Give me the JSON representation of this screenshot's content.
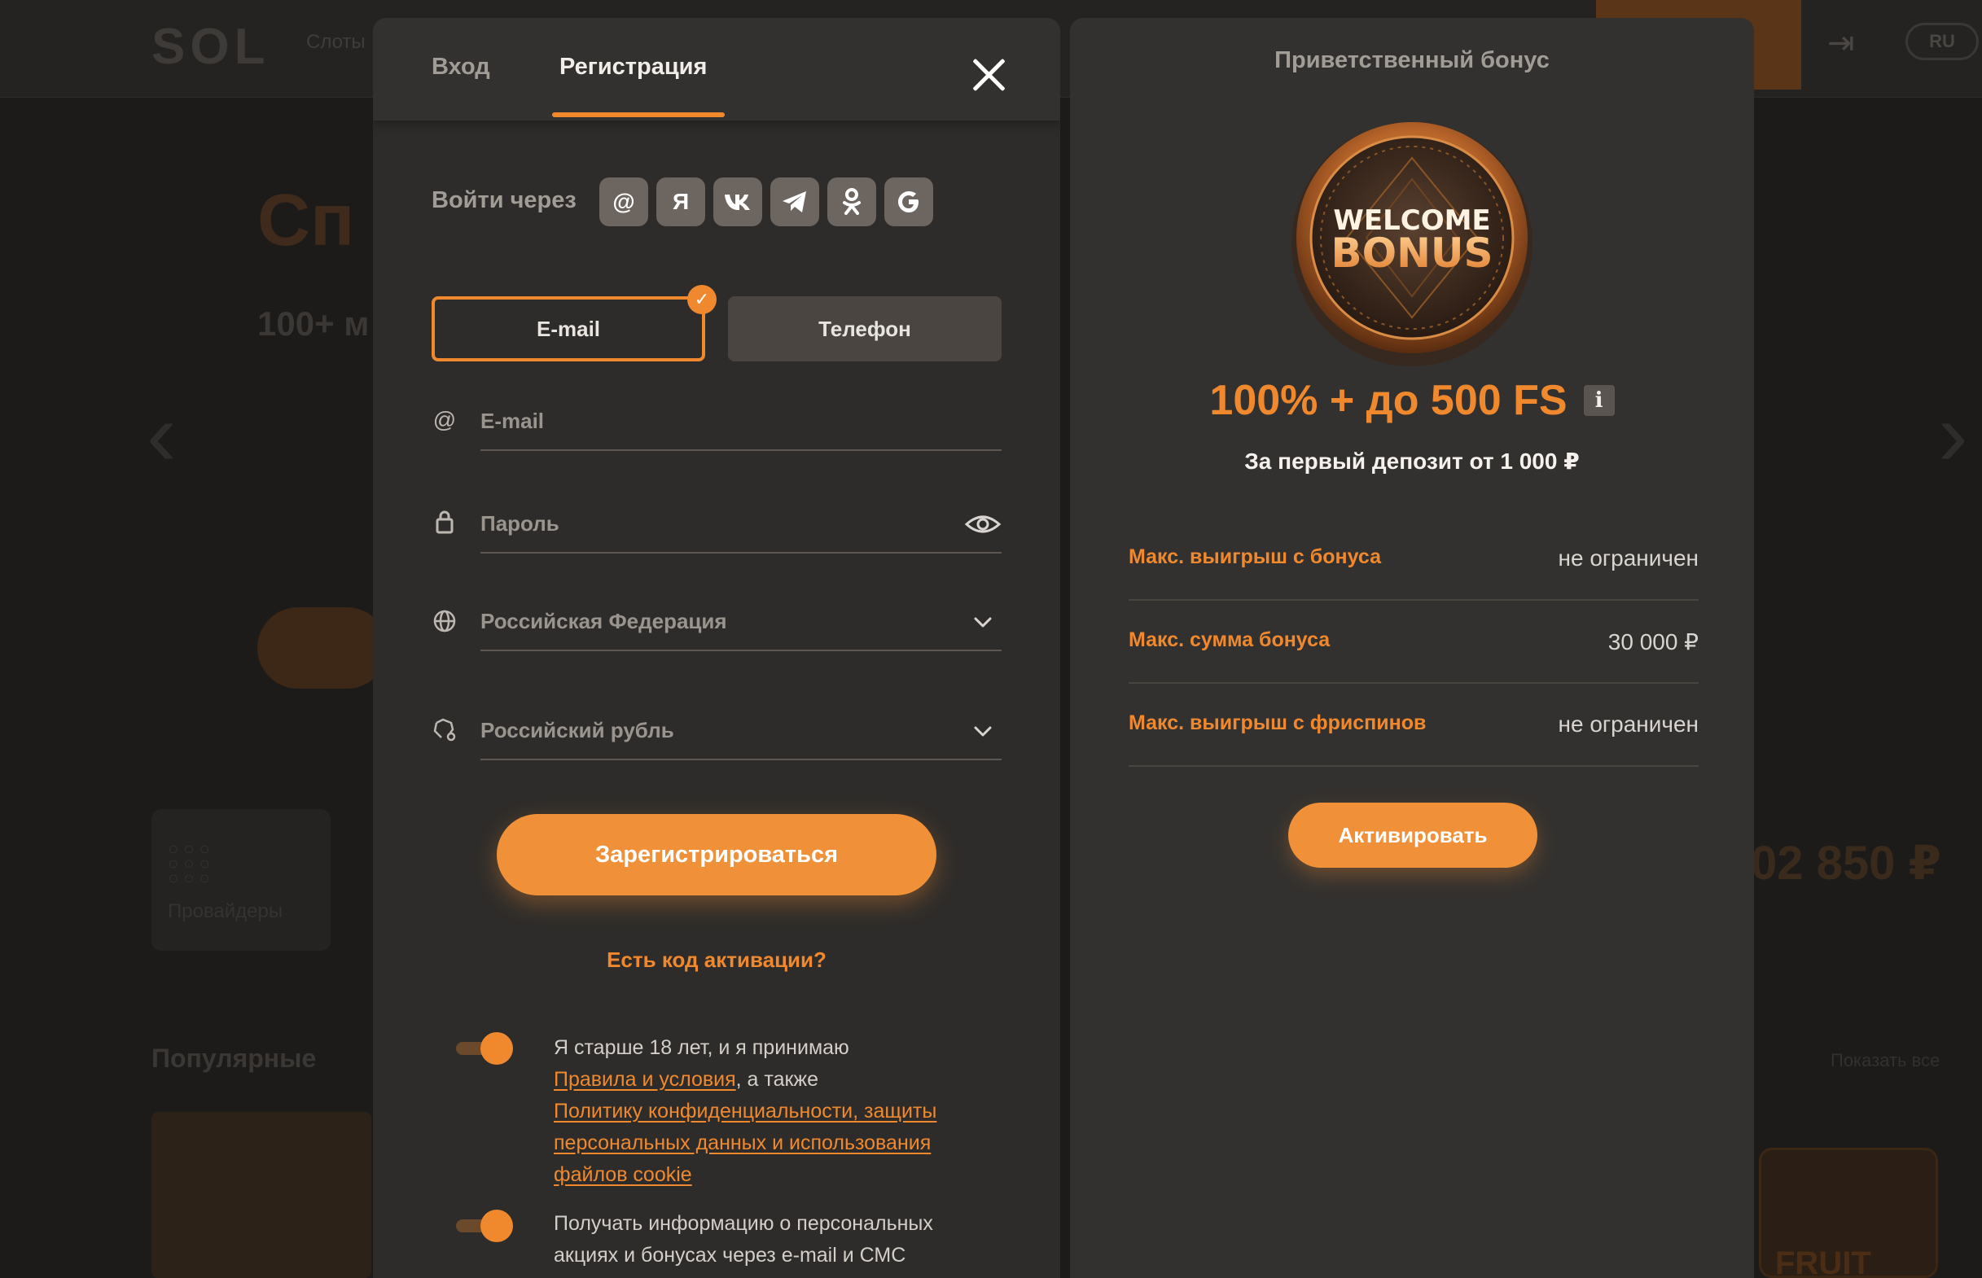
{
  "background": {
    "logo": "SOL",
    "nav_item": "Слоты",
    "hero_title": "Сп",
    "hero_subtitle": "100+ м",
    "language": "RU",
    "tile_label": "Провайдеры",
    "section_title": "Популярные",
    "show_all": "Показать все",
    "jackpot": "02 850 ₽",
    "game_label": "FRUIT"
  },
  "registration": {
    "tabs": {
      "login": "Вход",
      "register": "Регистрация"
    },
    "social": {
      "label": "Войти через",
      "providers": [
        {
          "name": "mail-ru",
          "glyph": "@"
        },
        {
          "name": "yandex",
          "glyph": "Я"
        },
        {
          "name": "vk",
          "glyph": "VK"
        },
        {
          "name": "telegram",
          "glyph": "✈"
        },
        {
          "name": "odnoklassniki",
          "glyph": "OK"
        },
        {
          "name": "google",
          "glyph": "G"
        }
      ]
    },
    "methods": {
      "email": "E-mail",
      "phone": "Телефон",
      "selected": "email"
    },
    "fields": {
      "email_placeholder": "E-mail",
      "password_placeholder": "Пароль",
      "country": "Российская Федерация",
      "currency": "Российский рубль"
    },
    "submit_label": "Зарегистрироваться",
    "activation_link": "Есть код активации?",
    "consent_age": {
      "checked": true,
      "text_before": "Я старше 18 лет, и я принимаю",
      "rules_link": "Правила и условия",
      "text_middle": ", а также",
      "privacy_link": "Политику конфиденциальности, защиты персональных данных и использования файлов cookie"
    },
    "consent_promo": {
      "checked": true,
      "text": "Получать информацию о персональных акциях и бонусах через e-mail и СМС"
    }
  },
  "bonus": {
    "title": "Приветственный бонус",
    "badge_line1": "WELCOME",
    "badge_line2": "BONUS",
    "headline": "100% + до 500 FS",
    "info_glyph": "i",
    "subtitle": "За первый депозит от 1 000 ₽",
    "rows": [
      {
        "label": "Макс. выигрыш с бонуса",
        "value": "не ограничен"
      },
      {
        "label": "Макс. сумма бонуса",
        "value": "30 000 ₽"
      },
      {
        "label": "Макс. выигрыш с фриспинов",
        "value": "не ограничен"
      }
    ],
    "activate_label": "Активировать"
  },
  "colors": {
    "accent": "#f0892e",
    "panel": "#2e2c2a",
    "panel_alt": "#33312f",
    "text_muted": "#a19c96"
  }
}
